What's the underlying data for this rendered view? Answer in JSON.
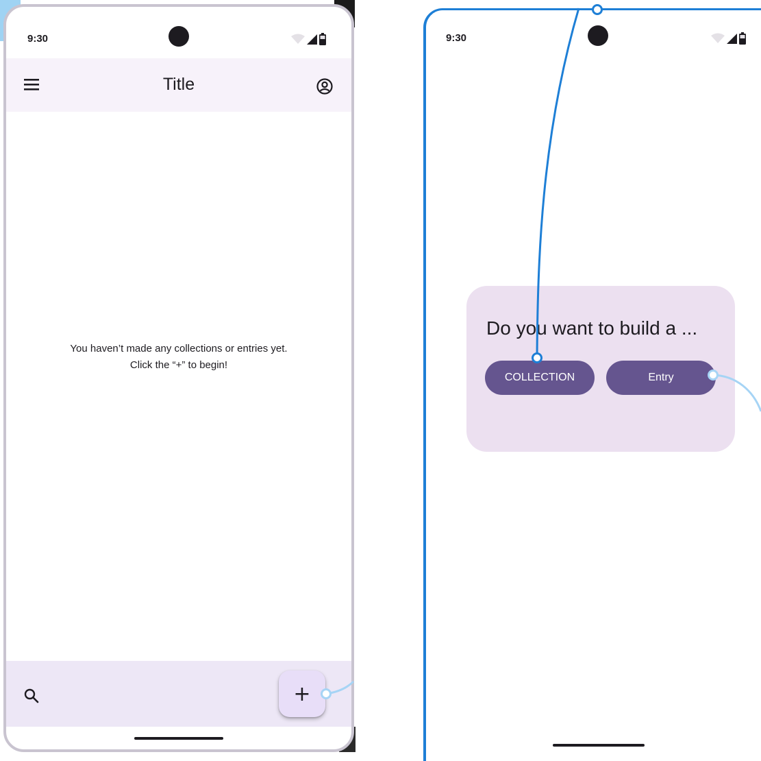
{
  "left_screen": {
    "status_bar": {
      "time": "9:30"
    },
    "top_app_bar": {
      "title": "Title",
      "menu_icon": "menu-icon",
      "account_icon": "account-circle-icon"
    },
    "empty_state": {
      "line1": "You haven’t made any collections or entries yet.",
      "line2": "Click the “+” to begin!"
    },
    "bottom_bar": {
      "search_icon": "search-icon"
    },
    "fab": {
      "label": "+"
    }
  },
  "right_screen": {
    "status_bar": {
      "time": "9:30"
    },
    "dialog": {
      "title": "Do you want to build a ...",
      "collection_button": "COLLECTION",
      "entry_button": "Entry"
    }
  },
  "colors": {
    "primary": "#65558f",
    "dialog_bg": "#ece0f0",
    "top_bar_bg": "#f7f2fa",
    "bottom_bar_bg": "#ede7f6",
    "fab_bg": "#e8def8",
    "connector": "#1e7fd6"
  }
}
